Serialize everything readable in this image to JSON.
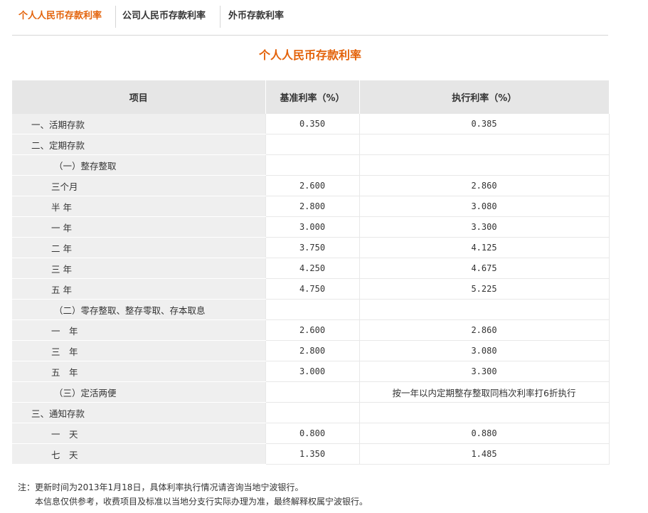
{
  "tabs": [
    {
      "label": "个人人民币存款利率",
      "active": true
    },
    {
      "label": "公司人民币存款利率",
      "active": false
    },
    {
      "label": "外币存款利率",
      "active": false
    }
  ],
  "page_title": "个人人民币存款利率",
  "table": {
    "headers": [
      "项目",
      "基准利率（%）",
      "执行利率（%）"
    ],
    "rows": [
      {
        "item": "一、活期存款",
        "indent": 1,
        "base": "0.350",
        "exec": "0.385"
      },
      {
        "item": "二、定期存款",
        "indent": 1,
        "base": "",
        "exec": ""
      },
      {
        "item": "（一）整存整取",
        "indent": 2,
        "base": "",
        "exec": ""
      },
      {
        "item": "三个月",
        "indent": 3,
        "base": "2.600",
        "exec": "2.860"
      },
      {
        "item": "半 年",
        "indent": 3,
        "base": "2.800",
        "exec": "3.080"
      },
      {
        "item": "一 年",
        "indent": 3,
        "base": "3.000",
        "exec": "3.300"
      },
      {
        "item": "二 年",
        "indent": 3,
        "base": "3.750",
        "exec": "4.125"
      },
      {
        "item": "三 年",
        "indent": 3,
        "base": "4.250",
        "exec": "4.675"
      },
      {
        "item": "五 年",
        "indent": 3,
        "base": "4.750",
        "exec": "5.225"
      },
      {
        "item": "（二）零存整取、整存零取、存本取息",
        "indent": 2,
        "base": "",
        "exec": ""
      },
      {
        "item": "一　年",
        "indent": 3,
        "base": "2.600",
        "exec": "2.860"
      },
      {
        "item": "三　年",
        "indent": 3,
        "base": "2.800",
        "exec": "3.080"
      },
      {
        "item": "五　年",
        "indent": 3,
        "base": "3.000",
        "exec": "3.300"
      },
      {
        "item": "（三）定活两便",
        "indent": 2,
        "base": "",
        "exec": "按一年以内定期整存整取同档次利率打6折执行",
        "exec_is_text": true
      },
      {
        "item": "三、通知存款",
        "indent": 1,
        "base": "",
        "exec": ""
      },
      {
        "item": "一　天",
        "indent": 3,
        "base": "0.800",
        "exec": "0.880"
      },
      {
        "item": "七　天",
        "indent": 3,
        "base": "1.350",
        "exec": "1.485"
      }
    ]
  },
  "notes": {
    "line1": "注：更新时间为2013年1月18日，具体利率执行情况请咨询当地宁波银行。",
    "line2": "本信息仅供参考，收费项目及标准以当地分支行实际办理为准，最终解释权属宁波银行。"
  }
}
